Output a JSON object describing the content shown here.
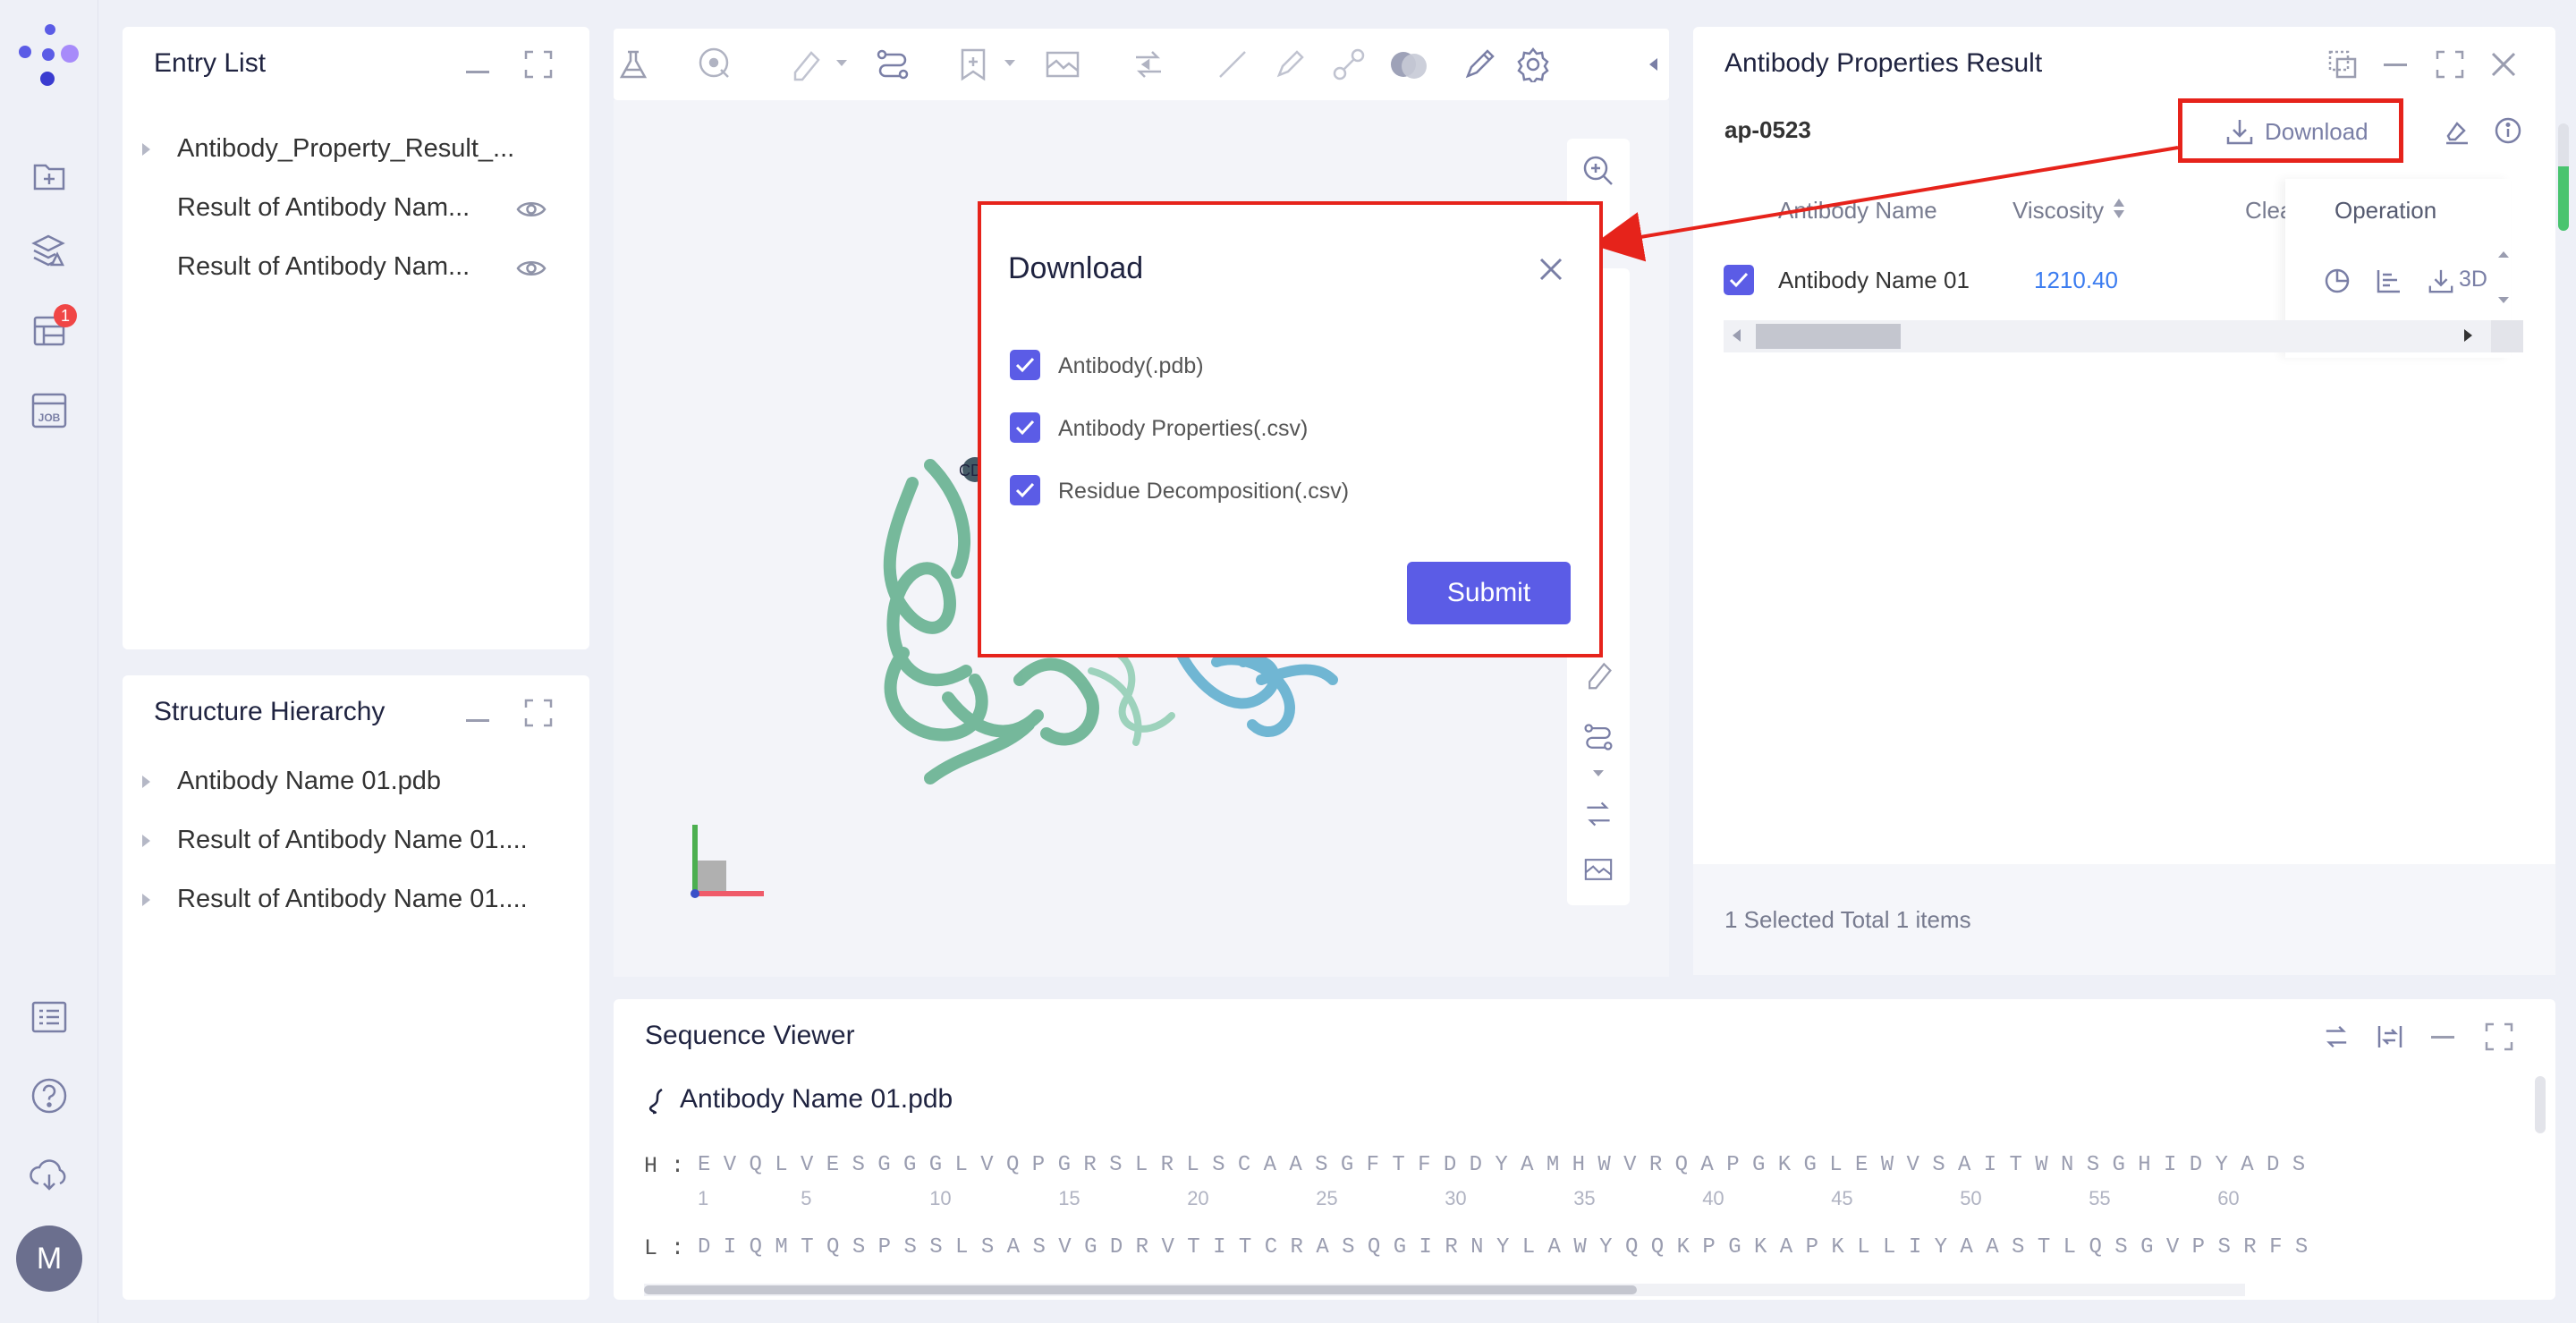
{
  "user": {
    "avatar_initial": "M"
  },
  "rail": {
    "badge_count": "1",
    "job_label": "JOB"
  },
  "entry_list": {
    "title": "Entry List",
    "items": [
      {
        "label": "Antibody_Property_Result_..."
      },
      {
        "label": "Result of Antibody Nam..."
      },
      {
        "label": "Result of Antibody Nam..."
      }
    ]
  },
  "structure_hierarchy": {
    "title": "Structure Hierarchy",
    "items": [
      {
        "label": "Antibody Name 01.pdb"
      },
      {
        "label": "Result of Antibody Name 01...."
      },
      {
        "label": "Result of Antibody Name 01...."
      }
    ]
  },
  "viewer": {
    "cd_label": "CD"
  },
  "result_panel": {
    "title": "Antibody Properties Result",
    "job_id": "ap-0523",
    "download_label": "Download",
    "columns": [
      "Antibody Name",
      "Viscosity",
      "Clea",
      "Operation"
    ],
    "rows": [
      {
        "name": "Antibody Name 01",
        "viscosity": "1210.40",
        "op_3d": "3D"
      }
    ],
    "footer": "1 Selected Total 1 items"
  },
  "download_dialog": {
    "title": "Download",
    "options": [
      {
        "label": "Antibody(.pdb)",
        "checked": true
      },
      {
        "label": "Antibody Properties(.csv)",
        "checked": true
      },
      {
        "label": "Residue Decomposition(.csv)",
        "checked": true
      }
    ],
    "submit_label": "Submit"
  },
  "sequence_viewer": {
    "title": "Sequence Viewer",
    "file_name": "Antibody Name 01.pdb",
    "heavy_label": "H :",
    "heavy_seq": "E V Q L V E S G G G L V Q P G R S L R L S C A A S G F T F D D Y A M H W V R Q A P G K G L E W V S A I T W N S G H I D Y A D S",
    "heavy_numbers": [
      "1",
      "5",
      "10",
      "15",
      "20",
      "25",
      "30",
      "35",
      "40",
      "45",
      "50",
      "55",
      "60"
    ],
    "light_label": "L :",
    "light_seq": "D I Q M T Q S P S S L S A S V G D R V T I T C R A S Q G I R N Y L A W Y Q Q K P G K A P K L L I Y A A S T L Q S G V P S R F S"
  },
  "colors": {
    "accent": "#5b5ce6",
    "highlight_red": "#e6231b",
    "link_blue": "#3b7cf0",
    "antibody_green": "#6fb596",
    "antibody_blue": "#6ab3d1"
  }
}
